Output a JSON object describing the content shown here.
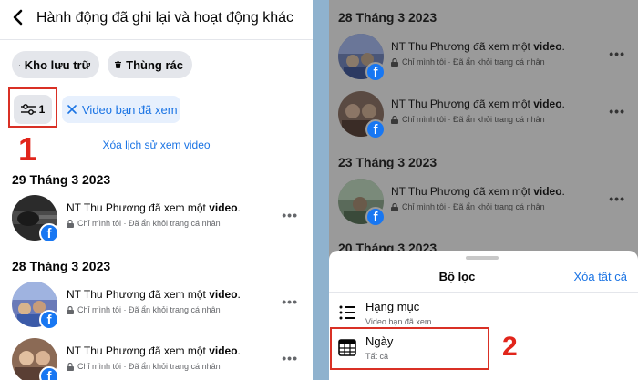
{
  "header": {
    "title": "Hành động đã ghi lại và hoạt động khác"
  },
  "pills": {
    "archive": "Kho lưu trữ",
    "trash": "Thùng rác"
  },
  "filter": {
    "count": "1",
    "chip": "Video bạn đã xem",
    "step_label": "1"
  },
  "clear_history": "Xóa lịch sử xem video",
  "left_groups": [
    {
      "date": "29 Tháng 3 2023"
    },
    {
      "date": "28 Tháng 3 2023"
    }
  ],
  "entry": {
    "prefix": "NT Thu Phương đã xem một ",
    "bold": "video",
    "suffix": ".",
    "privacy": "Chỉ mình tôi · Đã ẩn khỏi trang cá nhân",
    "more": "•••"
  },
  "right_groups": [
    {
      "date": "28 Tháng 3 2023"
    },
    {
      "date": "23 Tháng 3 2023"
    },
    {
      "date": "20 Tháng 3 2023"
    }
  ],
  "sheet": {
    "title": "Bộ lọc",
    "clear_all": "Xóa tất cả",
    "options": [
      {
        "label": "Hạng mục",
        "sub": "Video bạn đã xem",
        "icon": "list-icon"
      },
      {
        "label": "Ngày",
        "sub": "Tất cả",
        "icon": "calendar-icon"
      }
    ],
    "step_label": "2"
  },
  "colors": {
    "accent": "#1b74e4",
    "facebook": "#1877f2",
    "highlight": "#d93025"
  }
}
